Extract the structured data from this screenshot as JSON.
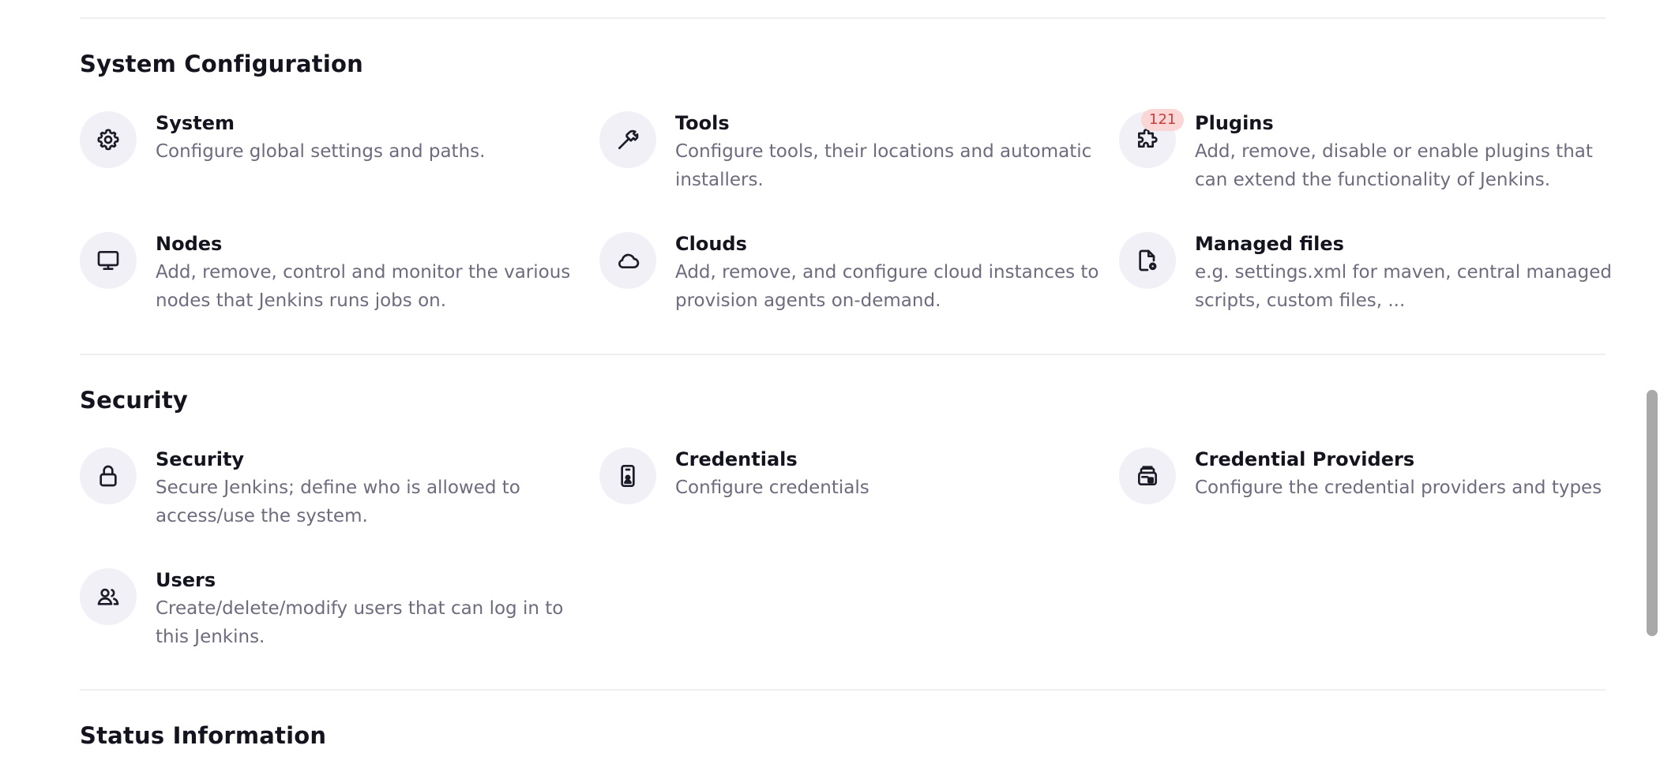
{
  "sections": {
    "system_configuration": {
      "title": "System Configuration",
      "items": [
        {
          "title": "System",
          "description": "Configure global settings and paths.",
          "icon": "gear-icon"
        },
        {
          "title": "Tools",
          "description": "Configure tools, their locations and automatic installers.",
          "icon": "hammer-icon"
        },
        {
          "title": "Plugins",
          "description": "Add, remove, disable or enable plugins that can extend the functionality of Jenkins.",
          "icon": "puzzle-icon",
          "badge": "121"
        },
        {
          "title": "Nodes",
          "description": "Add, remove, control and monitor the various nodes that Jenkins runs jobs on.",
          "icon": "monitor-icon"
        },
        {
          "title": "Clouds",
          "description": "Add, remove, and configure cloud instances to provision agents on-demand.",
          "icon": "cloud-icon"
        },
        {
          "title": "Managed files",
          "description": "e.g. settings.xml for maven, central managed scripts, custom files, ...",
          "icon": "file-settings-icon"
        }
      ]
    },
    "security": {
      "title": "Security",
      "items": [
        {
          "title": "Security",
          "description": "Secure Jenkins; define who is allowed to access/use the system.",
          "icon": "lock-icon"
        },
        {
          "title": "Credentials",
          "description": "Configure credentials",
          "icon": "credential-card-icon"
        },
        {
          "title": "Credential Providers",
          "description": "Configure the credential providers and types",
          "icon": "credential-providers-icon"
        },
        {
          "title": "Users",
          "description": "Create/delete/modify users that can log in to this Jenkins.",
          "icon": "users-icon"
        }
      ]
    },
    "status_information": {
      "title": "Status Information"
    }
  },
  "colors": {
    "badge_background": "#fbd6d6",
    "badge_text": "#c33f3f",
    "icon_background": "#f0f0f6",
    "description_text": "#6c6c7e"
  }
}
